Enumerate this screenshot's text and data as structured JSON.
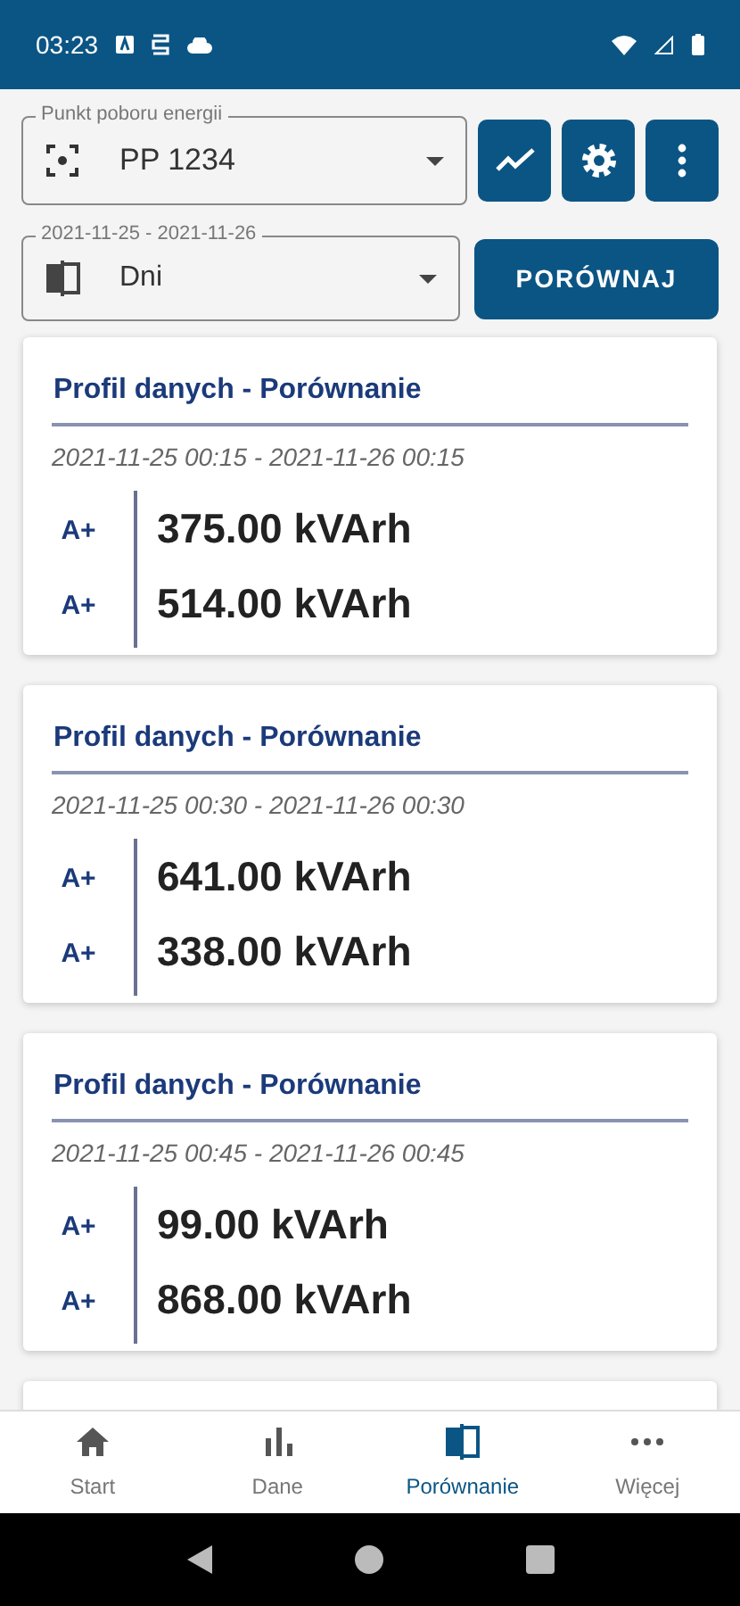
{
  "status_bar": {
    "time": "03:23"
  },
  "point_field": {
    "label": "Punkt poboru energii",
    "value": "PP 1234"
  },
  "period_field": {
    "label": "2021-11-25 - 2021-11-26",
    "value": "Dni"
  },
  "compare_button": "PORÓWNAJ",
  "cards": [
    {
      "title": "Profil danych - Porównanie",
      "range": "2021-11-25 00:15 - 2021-11-26 00:15",
      "rows": [
        {
          "label": "A+",
          "value": "375.00 kVArh"
        },
        {
          "label": "A+",
          "value": "514.00 kVArh"
        }
      ]
    },
    {
      "title": "Profil danych - Porównanie",
      "range": "2021-11-25 00:30 - 2021-11-26 00:30",
      "rows": [
        {
          "label": "A+",
          "value": "641.00 kVArh"
        },
        {
          "label": "A+",
          "value": "338.00 kVArh"
        }
      ]
    },
    {
      "title": "Profil danych - Porównanie",
      "range": "2021-11-25 00:45 - 2021-11-26 00:45",
      "rows": [
        {
          "label": "A+",
          "value": "99.00 kVArh"
        },
        {
          "label": "A+",
          "value": "868.00 kVArh"
        }
      ]
    }
  ],
  "bottom_nav": [
    {
      "label": "Start",
      "kind": "home",
      "selected": false
    },
    {
      "label": "Dane",
      "kind": "chart",
      "selected": false
    },
    {
      "label": "Porównanie",
      "kind": "compare",
      "selected": true
    },
    {
      "label": "Więcej",
      "kind": "more",
      "selected": false
    }
  ]
}
